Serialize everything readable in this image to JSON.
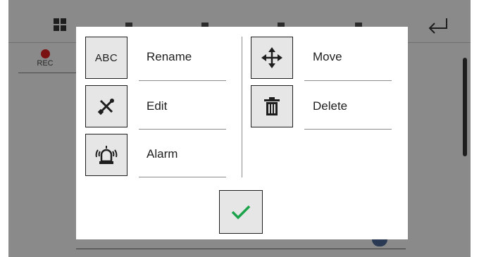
{
  "background": {
    "rec_label": "REC"
  },
  "dialog": {
    "items": [
      {
        "label": "Rename",
        "icon": "abc-icon",
        "icon_text": "ABC"
      },
      {
        "label": "Edit",
        "icon": "wrench-screwdriver-icon"
      },
      {
        "label": "Alarm",
        "icon": "alarm-siren-icon"
      },
      {
        "label": "Move",
        "icon": "move-arrows-icon"
      },
      {
        "label": "Delete",
        "icon": "trash-icon"
      }
    ],
    "confirm_icon": "checkmark-icon"
  },
  "colors": {
    "backdrop": "#8a8a8a",
    "button_fill": "#e6e6e6",
    "confirm_check": "#1aa34a",
    "rec_dot": "#7a1212"
  }
}
